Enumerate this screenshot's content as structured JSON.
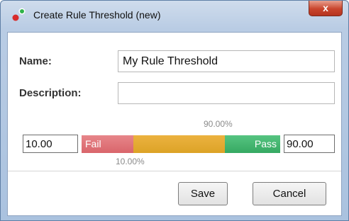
{
  "window": {
    "title": "Create Rule Threshold (new)",
    "close_label": "x"
  },
  "form": {
    "name_label": "Name:",
    "name_value": "My Rule Threshold",
    "description_label": "Description:",
    "description_value": ""
  },
  "threshold": {
    "low_value": "10.00",
    "high_value": "90.00",
    "low_percent_label": "10.00%",
    "high_percent_label": "90.00%",
    "fail_label": "Fail",
    "pass_label": "Pass",
    "low_fraction": 0.1,
    "high_fraction": 0.9,
    "colors": {
      "fail": "#d9656b",
      "middle": "#dca327",
      "pass": "#36a962"
    }
  },
  "buttons": {
    "save_label": "Save",
    "cancel_label": "Cancel"
  }
}
